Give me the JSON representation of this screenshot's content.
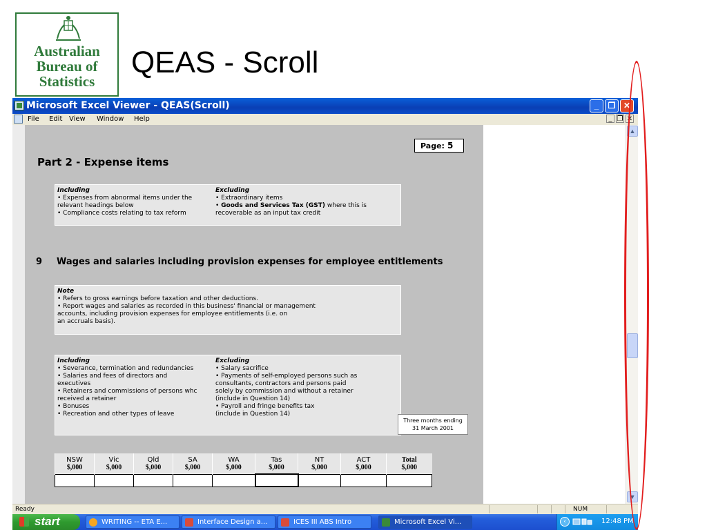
{
  "slide": {
    "logo_lines": [
      "Australian",
      "Bureau of",
      "Statistics"
    ],
    "title": "QEAS - Scroll"
  },
  "window": {
    "title": "Microsoft Excel Viewer - QEAS(Scroll)",
    "menu": [
      "File",
      "Edit",
      "View",
      "Window",
      "Help"
    ]
  },
  "sheet": {
    "page_label": "Page:",
    "page_number": "5",
    "part_heading": "Part 2 - Expense items",
    "expense_box": {
      "including_header": "Including",
      "including_lines": [
        "• Expenses from abnormal items under the",
        "   relevant headings below",
        "• Compliance costs relating to tax reform"
      ],
      "excluding_header": "Excluding",
      "excluding_lines": [
        "• Extraordinary items",
        "   recoverable as an input tax credit"
      ],
      "gst_bold": "Goods and Services Tax (GST)",
      "gst_rest": " where this is",
      "gst_bullet": "• "
    },
    "question_number": "9",
    "question_text": "Wages and salaries including provision expenses for employee entitlements",
    "note_box": {
      "header": "Note",
      "lines": [
        "• Refers to gross earnings before taxation and other deductions.",
        "• Report wages and salaries as recorded in this business' financial or management",
        "   accounts, including provision expenses for employee entitlements (i.e. on",
        "   an accruals basis)."
      ]
    },
    "wages_box": {
      "including_header": "Including",
      "including_lines": [
        "• Severance, termination and redundancies",
        "• Salaries and fees of directors and",
        "   executives",
        "• Retainers and commissions of persons whc",
        "   received a retainer",
        "• Bonuses",
        "• Recreation and other types of leave"
      ],
      "excluding_header": "Excluding",
      "excluding_lines": [
        "• Salary sacrifice",
        "• Payments of self-employed persons such as",
        "   consultants, contractors and persons paid",
        "   solely by commission and without a retainer",
        "   (include in Question 14)",
        "• Payroll and fringe benefits tax",
        "   (include in Question 14)"
      ]
    },
    "period_lines": [
      "Three months ending",
      "31 March 2001"
    ],
    "table": {
      "headers": [
        "NSW",
        "Vic",
        "Qld",
        "SA",
        "WA",
        "Tas",
        "NT",
        "ACT",
        "Total"
      ],
      "unit": "$,000"
    }
  },
  "status": {
    "ready": "Ready",
    "num": "NUM"
  },
  "taskbar": {
    "start": "start",
    "tasks": [
      "WRITING -- ETA E...",
      "Interface Design a...",
      "ICES III ABS Intro",
      "Microsoft Excel Vi..."
    ],
    "clock": "12:48 PM"
  },
  "colors": {
    "titlebar": "#0a4bc8",
    "sheet_bg": "#c0c0c0",
    "annotation": "#e21e1e",
    "logo_green": "#2f7a3a"
  }
}
